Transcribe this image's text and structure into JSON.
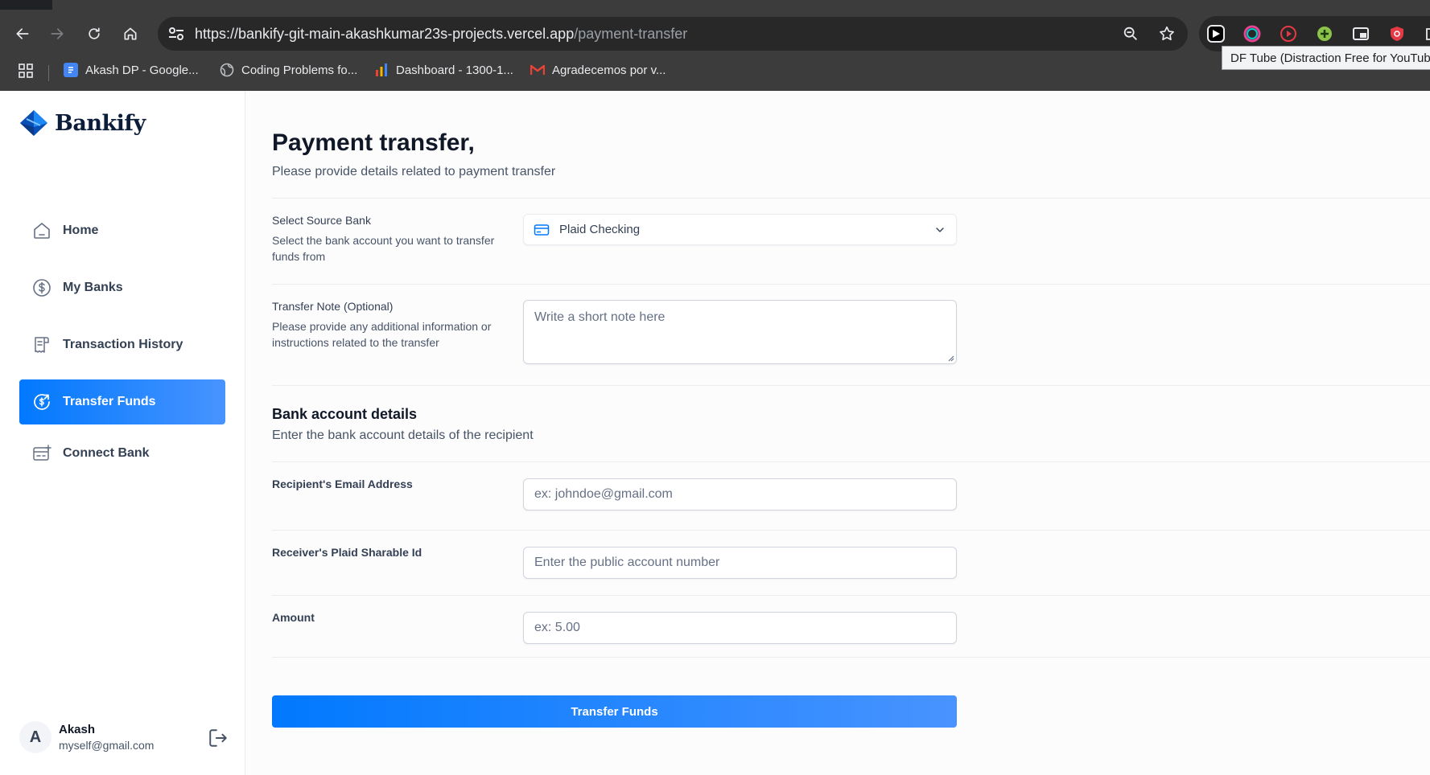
{
  "browser": {
    "url_host": "https://bankify-git-main-akashkumar23s-projects.vercel.app",
    "url_path": "/payment-transfer",
    "bookmarks": [
      {
        "label": "Akash DP - Google...",
        "icon": "google-docs-icon",
        "color": "#4285f4"
      },
      {
        "label": "Coding Problems fo...",
        "icon": "globe-icon",
        "color": "#9aa0a6"
      },
      {
        "label": "Dashboard - 1300-1...",
        "icon": "bar-chart-icon",
        "color": "#f4b400"
      },
      {
        "label": "Agradecemos por v...",
        "icon": "gmail-icon",
        "color": "#ea4335"
      }
    ],
    "tooltip": "DF Tube (Distraction Free for YouTube)"
  },
  "sidebar": {
    "brand": "Bankify",
    "items": [
      {
        "label": "Home",
        "icon": "home-icon",
        "active": false
      },
      {
        "label": "My Banks",
        "icon": "dollar-circle-icon",
        "active": false
      },
      {
        "label": "Transaction History",
        "icon": "receipt-icon",
        "active": false
      },
      {
        "label": "Transfer Funds",
        "icon": "money-send-icon",
        "active": true
      },
      {
        "label": "Connect Bank",
        "icon": "connect-bank-icon",
        "active": false
      }
    ],
    "user": {
      "initial": "A",
      "name": "Akash",
      "email": "myself@gmail.com"
    }
  },
  "page": {
    "title": "Payment transfer,",
    "subtitle": "Please provide details related to payment transfer"
  },
  "form": {
    "source_bank": {
      "label": "Select Source Bank",
      "help": "Select the bank account you want to transfer funds from",
      "value": "Plaid Checking"
    },
    "note": {
      "label": "Transfer Note (Optional)",
      "help": "Please provide any additional information or instructions related to the transfer",
      "placeholder": "Write a short note here"
    },
    "bank_details": {
      "title": "Bank account details",
      "subtitle": "Enter the bank account details of the recipient"
    },
    "email": {
      "label": "Recipient's Email Address",
      "placeholder": "ex: johndoe@gmail.com"
    },
    "sharable_id": {
      "label": "Receiver's Plaid Sharable Id",
      "placeholder": "Enter the public account number"
    },
    "amount": {
      "label": "Amount",
      "placeholder": "ex: 5.00"
    },
    "submit_label": "Transfer Funds"
  },
  "colors": {
    "accent": "#0179fe",
    "accent_light": "#4893ff",
    "brand_dark": "#0b1d39"
  }
}
